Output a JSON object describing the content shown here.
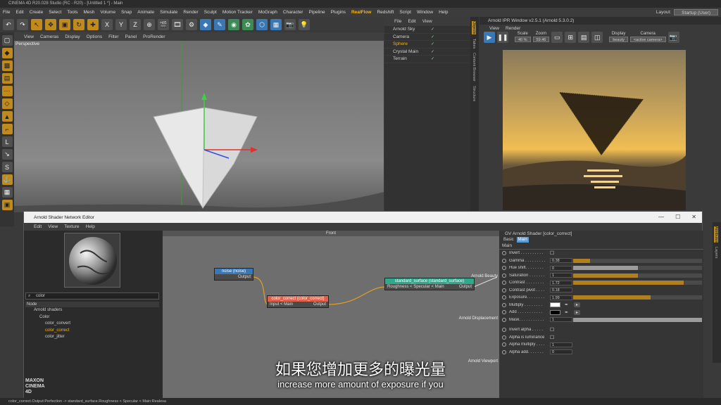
{
  "app": {
    "title": "CINEMA 4D R20.028 Studio (RC - R20) - [Untitled 1 *] - Main"
  },
  "menubar": {
    "items": [
      "File",
      "Edit",
      "Create",
      "Select",
      "Tools",
      "Mesh",
      "Volume",
      "Snap",
      "Animate",
      "Simulate",
      "Render",
      "Sculpt",
      "Motion Tracker",
      "MoGraph",
      "Character",
      "Pipeline",
      "Plugins",
      "RealFlow",
      "Redshift",
      "Script",
      "Window",
      "Help"
    ],
    "highlight": "RealFlow",
    "layout_label": "Layout:",
    "layout_value": "Startup (User)"
  },
  "toolbar": {
    "axis_x": "X",
    "axis_y": "Y",
    "axis_z": "Z"
  },
  "viewport": {
    "menu": [
      "View",
      "Cameras",
      "Display",
      "Options",
      "Filter",
      "Panel",
      "ProRender"
    ],
    "label": "Perspective"
  },
  "object_manager": {
    "menu": [
      "File",
      "Edit",
      "View"
    ],
    "objects": [
      {
        "name": "Arnold Sky",
        "selected": false
      },
      {
        "name": "Camera",
        "selected": false
      },
      {
        "name": "Sphere",
        "selected": true
      },
      {
        "name": "Crystal Main",
        "selected": false
      },
      {
        "name": "Terrain",
        "selected": false
      }
    ]
  },
  "side_tabs": [
    "Objects",
    "Takes",
    "Content Browser",
    "Structure"
  ],
  "ipr": {
    "title": "Arnold IPR Window v2.5.1 (Arnold 5.3.0.2)",
    "menu": [
      "View",
      "Render"
    ],
    "scale_label": "Scale",
    "scale_value": "40 %",
    "zoom_label": "Zoom",
    "zoom_value": "59.46",
    "display_label": "Display",
    "display_value": "beauty",
    "camera_label": "Camera",
    "camera_value": "<active camera>"
  },
  "shader_editor": {
    "title": "Arnold Shader Network Editor",
    "menu": [
      "Edit",
      "View",
      "Texture",
      "Help"
    ],
    "search_value": "color",
    "tree_header": "Node",
    "tree": [
      {
        "label": "Arnold shaders",
        "indent": 1,
        "highlight": false
      },
      {
        "label": "Color",
        "indent": 2,
        "highlight": false
      },
      {
        "label": "color_convert",
        "indent": 3,
        "highlight": false
      },
      {
        "label": "color_correct",
        "indent": 3,
        "highlight": true
      },
      {
        "label": "color_jitter",
        "indent": 3,
        "highlight": false
      }
    ],
    "canvas_label": "Front",
    "nodes": {
      "noise": {
        "title": "noise (noise)",
        "output": "Output"
      },
      "color_correct": {
        "title": "color_correct (color_correct)",
        "input": "Input < Main",
        "output": "Output"
      },
      "standard_surface": {
        "title": "standard_surface (standard_surface)",
        "input": "Roughness < Specular < Main",
        "output": "Output"
      }
    },
    "ports": {
      "beauty": "Arnold Beauty",
      "displacement": "Arnold Displacement",
      "viewport": "Arnold Viewport"
    }
  },
  "attributes": {
    "header": "GV Arnold Shader [color_correct]",
    "tabs": [
      {
        "label": "Basic",
        "active": false
      },
      {
        "label": "Main",
        "active": true
      }
    ],
    "section": "Main",
    "rows": [
      {
        "name": "Invert . . . . . . . . . .",
        "type": "check"
      },
      {
        "name": "Gamma . . . . . . . . .",
        "value": "0.38",
        "fill": 0.13,
        "accent": true
      },
      {
        "name": "Hue shift. . . . . . . .",
        "value": "0",
        "fill": 0.5,
        "accent": false
      },
      {
        "name": "Saturation . . . . . . .",
        "value": "1",
        "fill": 0.5,
        "accent": true
      },
      {
        "name": "Contrast . . . . . . . .",
        "value": "1.72",
        "fill": 0.86,
        "accent": true
      },
      {
        "name": "Contrast pivot . . . .",
        "value": "0.18",
        "fill": 0,
        "accent": false
      },
      {
        "name": "Exposure. . . . . . . .",
        "value": "1.99",
        "fill": 0.6,
        "accent": true
      },
      {
        "name": "Multiply . . . . . . . .",
        "type": "swatch",
        "color": "#ffffff"
      },
      {
        "name": "Add . . . . . . . . . . .",
        "type": "swatch",
        "color": "#000000"
      },
      {
        "name": "Mask. . . . . . . . . . .",
        "value": "1",
        "fill": 1,
        "accent": false
      },
      {
        "name": "Invert alpha . . . . .",
        "type": "check"
      },
      {
        "name": "Alpha is luminance",
        "type": "check"
      },
      {
        "name": "Alpha multiply . . . .",
        "value": "1",
        "fill": 0,
        "accent": false
      },
      {
        "name": "Alpha add. . . . . . .",
        "value": "0",
        "fill": 0,
        "accent": false
      }
    ]
  },
  "right_tabs": [
    "Attributes",
    "Layers"
  ],
  "brand": "MAXON CINEMA 4D",
  "status": "color_correct.Output:Perfection -> standard_surface.Roughness < Specular < Main:Realesa",
  "subtitle": {
    "cn": "如果您增加更多的曝光量",
    "en": "increase more amount of exposure if you"
  },
  "colors": {
    "accent": "#c08a1c",
    "highlight": "#ffb300",
    "node_noise": "#3a78b5",
    "node_cc": "#e0604a",
    "node_ss": "#2fa98a"
  }
}
